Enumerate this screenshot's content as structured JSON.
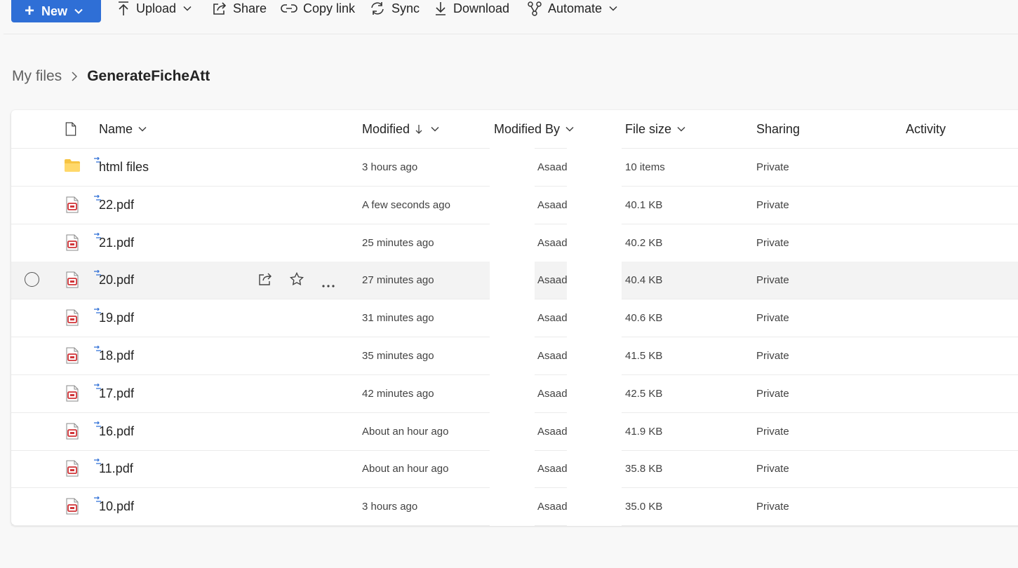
{
  "toolbar": {
    "new_label": "New",
    "upload_label": "Upload",
    "share_label": "Share",
    "copy_link_label": "Copy link",
    "sync_label": "Sync",
    "download_label": "Download",
    "automate_label": "Automate"
  },
  "breadcrumb": {
    "root": "My files",
    "current": "GenerateFicheAtt"
  },
  "columns": {
    "name": "Name",
    "modified": "Modified",
    "modified_by": "Modified By",
    "file_size": "File size",
    "sharing": "Sharing",
    "activity": "Activity"
  },
  "files": [
    {
      "name": "html files",
      "type": "folder",
      "modified": "3 hours ago",
      "modified_by": "Asaad",
      "size": "10 items",
      "sharing": "Private"
    },
    {
      "name": "22.pdf",
      "type": "pdf",
      "modified": "A few seconds ago",
      "modified_by": "Asaad",
      "size": "40.1 KB",
      "sharing": "Private"
    },
    {
      "name": "21.pdf",
      "type": "pdf",
      "modified": "25 minutes ago",
      "modified_by": "Asaad",
      "size": "40.2 KB",
      "sharing": "Private"
    },
    {
      "name": "20.pdf",
      "type": "pdf",
      "modified": "27 minutes ago",
      "modified_by": "Asaad",
      "size": "40.4 KB",
      "sharing": "Private"
    },
    {
      "name": "19.pdf",
      "type": "pdf",
      "modified": "31 minutes ago",
      "modified_by": "Asaad",
      "size": "40.6 KB",
      "sharing": "Private"
    },
    {
      "name": "18.pdf",
      "type": "pdf",
      "modified": "35 minutes ago",
      "modified_by": "Asaad",
      "size": "41.5 KB",
      "sharing": "Private"
    },
    {
      "name": "17.pdf",
      "type": "pdf",
      "modified": "42 minutes ago",
      "modified_by": "Asaad",
      "size": "42.5 KB",
      "sharing": "Private"
    },
    {
      "name": "16.pdf",
      "type": "pdf",
      "modified": "About an hour ago",
      "modified_by": "Asaad",
      "size": "41.9 KB",
      "sharing": "Private"
    },
    {
      "name": "11.pdf",
      "type": "pdf",
      "modified": "About an hour ago",
      "modified_by": "Asaad",
      "size": "35.8 KB",
      "sharing": "Private"
    },
    {
      "name": "10.pdf",
      "type": "pdf",
      "modified": "3 hours ago",
      "modified_by": "Asaad",
      "size": "35.0 KB",
      "sharing": "Private"
    }
  ],
  "colors": {
    "accent": "#2f6fd6",
    "folder": "#f6c443",
    "pdf": "#d13438"
  }
}
